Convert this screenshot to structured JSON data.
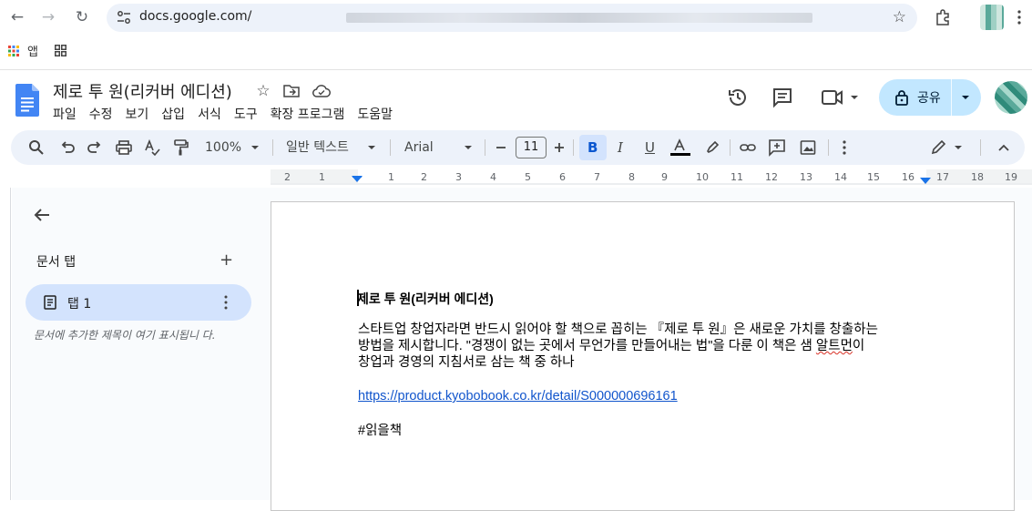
{
  "browser": {
    "url_host": "docs.google.com/",
    "bookmark_apps_label": "앱"
  },
  "docs": {
    "title": "제로 투 원(리커버 에디션)",
    "menu": [
      "파일",
      "수정",
      "보기",
      "삽입",
      "서식",
      "도구",
      "확장 프로그램",
      "도움말"
    ],
    "share_label": "공유"
  },
  "toolbar": {
    "zoom": "100%",
    "style": "일반 텍스트",
    "font": "Arial",
    "font_size": "11"
  },
  "ruler": [
    "2",
    "1",
    "1",
    "2",
    "3",
    "4",
    "5",
    "6",
    "7",
    "8",
    "9",
    "10",
    "11",
    "12",
    "13",
    "14",
    "15",
    "16",
    "17",
    "18",
    "19"
  ],
  "sidebar": {
    "heading": "문서 탭",
    "tab_label": "탭 1",
    "hint": "문서에 추가한 제목이 여기 표시됩니 다."
  },
  "document": {
    "heading": "제로 투 원(리커버 에디션)",
    "paragraph_line1": "스타트업 창업자라면 반드시 읽어야 할 책으로 꼽히는 『제로 투 원』은 새로운 가치를 창출하는",
    "paragraph_line2_a": "방법을 제시합니다. \"경쟁이 없는 곳에서 무언가를 만들어내는 법\"을 다룬 이 책은 샘 ",
    "paragraph_line2_spell": "알트먼",
    "paragraph_line2_b": "이",
    "paragraph_line3": "창업과 경영의 지침서로 삼는 책 중 하나",
    "link": "https://product.kyobobook.co.kr/detail/S000000696161",
    "hashtag": "#읽을책"
  },
  "colors": {
    "accent": "#0b57d0",
    "share_bg": "#c2e7ff",
    "link": "#1155cc"
  }
}
